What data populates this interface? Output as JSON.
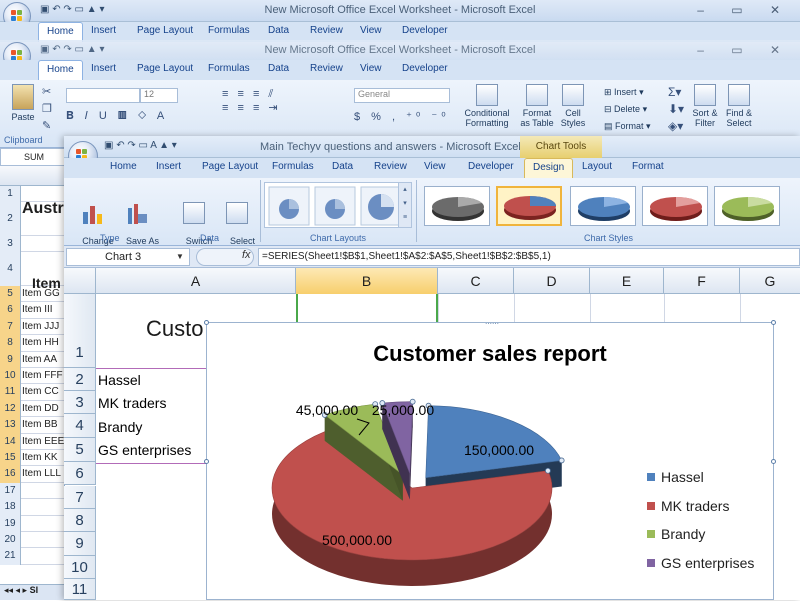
{
  "back_window": {
    "title": "New Microsoft Office Excel Worksheet - Microsoft Excel",
    "tabs": [
      "Home",
      "Insert",
      "Page Layout",
      "Formulas",
      "Data",
      "Review",
      "View",
      "Developer"
    ],
    "ribbon": {
      "paste": "Paste",
      "clipboard": "Clipboard",
      "font_size": "12",
      "number_format": "General",
      "cond_fmt": "Conditional\nFormatting",
      "format_table": "Format\nas Table",
      "cell_styles": "Cell\nStyles",
      "insert": "Insert",
      "delete": "Delete",
      "format": "Format",
      "sort": "Sort &\nFilter",
      "find": "Find &\nSelect"
    },
    "name_box": "SUM",
    "title_cell": "Austr",
    "item_hdr": "Item",
    "rows": [
      {
        "n": "1",
        "t": ""
      },
      {
        "n": "2",
        "t": ""
      },
      {
        "n": "3",
        "t": ""
      },
      {
        "n": "4",
        "t": ""
      },
      {
        "n": "5",
        "t": "Item GG"
      },
      {
        "n": "6",
        "t": "Item III"
      },
      {
        "n": "7",
        "t": "Item JJJ"
      },
      {
        "n": "8",
        "t": "Item HH"
      },
      {
        "n": "9",
        "t": "Item AA"
      },
      {
        "n": "10",
        "t": "Item FFF"
      },
      {
        "n": "11",
        "t": "Item CC"
      },
      {
        "n": "12",
        "t": "Item DD"
      },
      {
        "n": "13",
        "t": "Item BB"
      },
      {
        "n": "14",
        "t": "Item EEE"
      },
      {
        "n": "15",
        "t": "Item KK"
      },
      {
        "n": "16",
        "t": "Item LLL"
      },
      {
        "n": "17",
        "t": ""
      },
      {
        "n": "18",
        "t": ""
      },
      {
        "n": "19",
        "t": ""
      },
      {
        "n": "20",
        "t": ""
      },
      {
        "n": "21",
        "t": ""
      }
    ],
    "sheet_tab": "SI"
  },
  "front_window": {
    "title": "Main Techyv questions and answers - Microsoft Excel",
    "chart_tools": "Chart Tools",
    "tabs": [
      "Home",
      "Insert",
      "Page Layout",
      "Formulas",
      "Data",
      "Review",
      "View",
      "Developer",
      "Design",
      "Layout",
      "Format"
    ],
    "active_tab": "Design",
    "ribbon": {
      "change_type": "Change\nChart Type",
      "save_template": "Save As\nTemplate",
      "type_group": "Type",
      "switch_row": "Switch\nRow/Column",
      "select_data": "Select\nData",
      "data_group": "Data",
      "layouts_group": "Chart Layouts",
      "styles_group": "Chart Styles"
    },
    "name_box": "Chart 3",
    "fx": "fx",
    "formula": "=SERIES(Sheet1!$B$1,Sheet1!$A$2:$A$5,Sheet1!$B$2:$B$5,1)",
    "columns": [
      "A",
      "B",
      "C",
      "D",
      "E",
      "F",
      "G"
    ],
    "rows": [
      "1",
      "2",
      "3",
      "4",
      "5",
      "6",
      "7",
      "8",
      "9",
      "10",
      "11"
    ],
    "cell_a1": "Custo",
    "cells_a": [
      "Hassel",
      "MK traders",
      "Brandy",
      "GS enterprises"
    ]
  },
  "chart_data": {
    "type": "pie",
    "title": "Customer sales report",
    "categories": [
      "Hassel",
      "MK traders",
      "Brandy",
      "GS enterprises"
    ],
    "values": [
      150000,
      500000,
      45000,
      25000
    ],
    "labels": [
      "150,000.00",
      "500,000.00",
      "45,000.00",
      "25,000.00"
    ],
    "colors": [
      "#4f81bd",
      "#c0504d",
      "#9bbb59",
      "#8064a2"
    ],
    "legend_position": "right",
    "style": "3D exploded"
  },
  "colors": {
    "ribbon_blue": "#d5e3f4",
    "tab_text": "#15428b",
    "selected_col": "#f7d48a"
  }
}
